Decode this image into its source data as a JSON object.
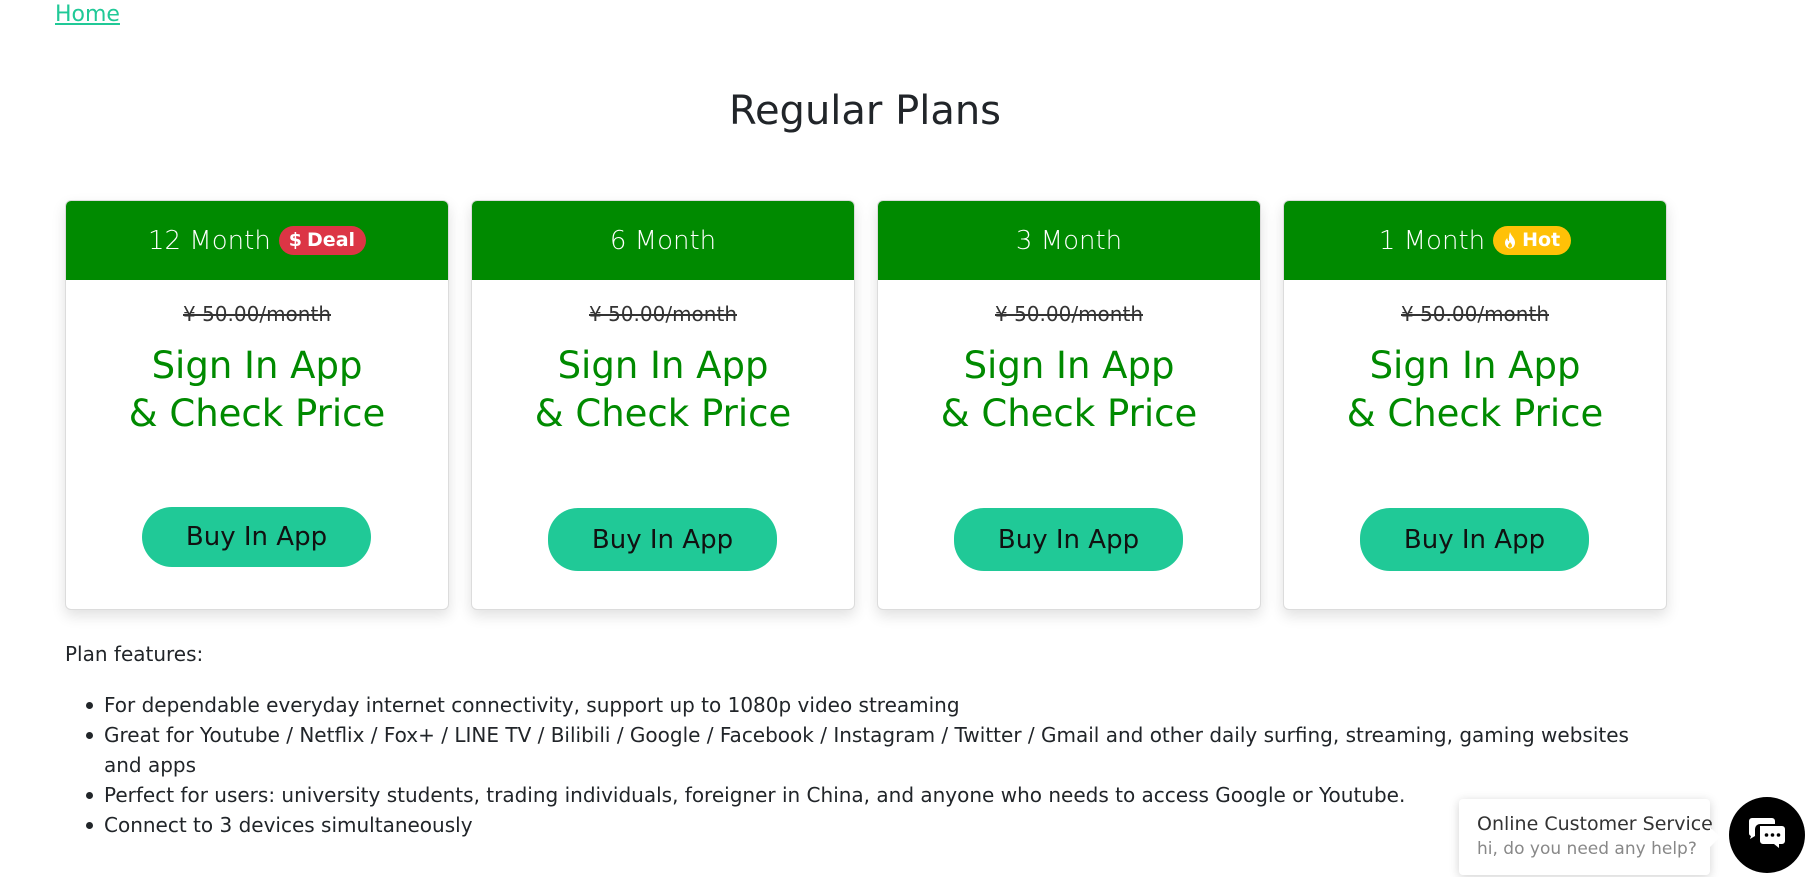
{
  "nav": {
    "home_label": "Home"
  },
  "section_title": "Regular Plans",
  "colors": {
    "header_green": "#008a00",
    "accent_teal": "#20c997",
    "deal_red": "#dc3545",
    "hot_yellow": "#ffc107"
  },
  "plans": [
    {
      "name": "12 Month",
      "badge": {
        "icon": "dollar-icon",
        "icon_glyph": "$",
        "label": "Deal"
      },
      "old_price": "¥ 50.00/month",
      "price_line_1": "Sign In App",
      "price_line_2": "& Check Price",
      "button_label": "Buy In App"
    },
    {
      "name": "6 Month",
      "old_price": "¥ 50.00/month",
      "price_line_1": "Sign In App",
      "price_line_2": "& Check Price",
      "button_label": "Buy In App"
    },
    {
      "name": "3 Month",
      "old_price": "¥ 50.00/month",
      "price_line_1": "Sign In App",
      "price_line_2": "& Check Price",
      "button_label": "Buy In App"
    },
    {
      "name": "1 Month",
      "badge": {
        "icon": "fire-icon",
        "label": "Hot"
      },
      "old_price": "¥ 50.00/month",
      "price_line_1": "Sign In App",
      "price_line_2": "& Check Price",
      "button_label": "Buy In App"
    }
  ],
  "features": {
    "label": "Plan features:",
    "items": [
      "For dependable everyday internet connectivity, support up to 1080p video streaming",
      "Great for Youtube / Netflix / Fox+ / LINE TV / Bilibili / Google / Facebook / Instagram / Twitter / Gmail and other daily surfing, streaming, gaming websites and apps",
      "Perfect for users: university students, trading individuals, foreigner in China, and anyone who needs to access Google or Youtube.",
      "Connect to 3 devices simultaneously"
    ]
  },
  "chat": {
    "title": "Online Customer Service",
    "subtitle": "hi, do you need any help?",
    "icon": "chat-icon"
  }
}
